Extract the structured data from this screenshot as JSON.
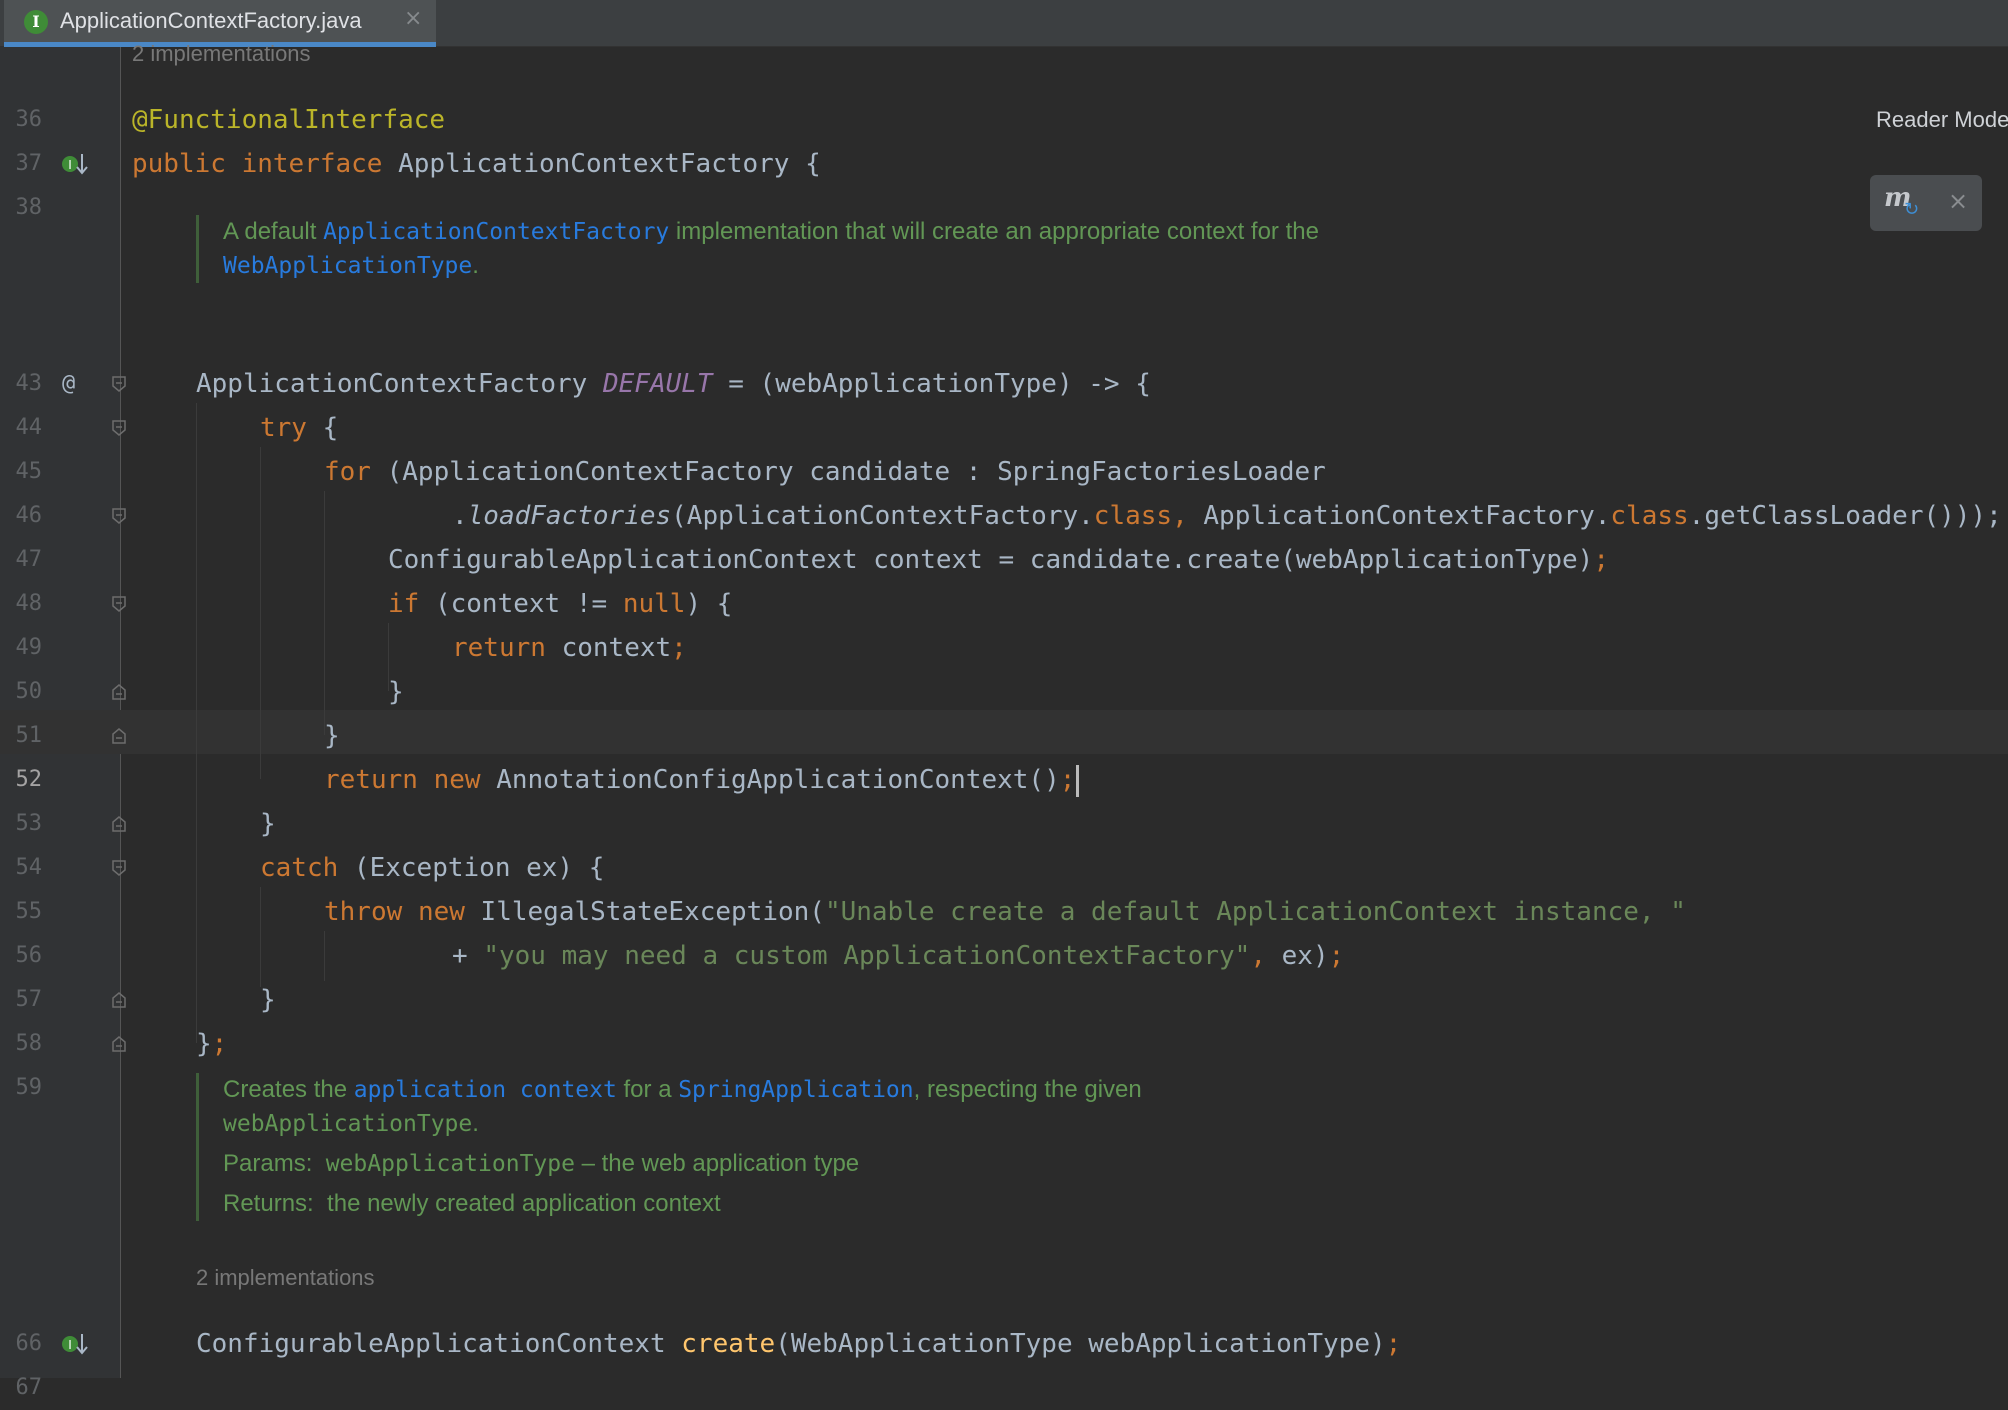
{
  "tab": {
    "file_icon_letter": "I",
    "filename": "ApplicationContextFactory.java",
    "close_glyph": "×"
  },
  "reader_mode": {
    "label": "Reader Mode",
    "maven_glyph": "m",
    "sync_glyph": "↻",
    "close_glyph": "×"
  },
  "hints": {
    "top_implementations": "2 implementations",
    "bottom_implementations": "2 implementations"
  },
  "gutter": {
    "line_numbers": [
      "36",
      "37",
      "38",
      "43",
      "44",
      "45",
      "46",
      "47",
      "48",
      "49",
      "50",
      "51",
      "52",
      "53",
      "54",
      "55",
      "56",
      "57",
      "58",
      "59",
      "66",
      "67"
    ],
    "current_line": "52",
    "at_marker": "@",
    "icons": [
      "implementation-down-arrow-icon",
      "override-at-icon",
      "fold-marker-icon"
    ]
  },
  "code": {
    "l36": "@FunctionalInterface",
    "l37_public": "public",
    "l37_interface": "interface",
    "l37_name": " ApplicationContextFactory {",
    "l43_type": "ApplicationContextFactory ",
    "l43_const": "DEFAULT",
    "l43_rest": " = (webApplicationType) -> {",
    "l44_try": "try",
    "l44_rest": " {",
    "l45_for": "for",
    "l45_rest": " (ApplicationContextFactory candidate : SpringFactoriesLoader",
    "l46_dot": ".",
    "l46_method": "loadFactories",
    "l46_a": "(ApplicationContextFactory.",
    "l46_class1": "class",
    "l46_comma": ", ",
    "l46_b": "ApplicationContextFactory.",
    "l46_class2": "class",
    "l46_c": ".getClassLoader()));",
    "l47": "ConfigurableApplicationContext context = candidate.create(webApplicationType)",
    "l47_semi": ";",
    "l48_if": "if",
    "l48_a": " (context != ",
    "l48_null": "null",
    "l48_b": ") {",
    "l49_return": "return",
    "l49_rest": " context",
    "l49_semi": ";",
    "l50": "}",
    "l51": "}",
    "l52_return": "return",
    "l52_new": "new",
    "l52_rest": " AnnotationConfigApplicationContext()",
    "l52_semi": ";",
    "l53": "}",
    "l54_catch": "catch",
    "l54_rest": " (Exception ex) {",
    "l55_throw": "throw",
    "l55_new": "new",
    "l55_rest": " IllegalStateException(",
    "l55_str": "\"Unable create a default ApplicationContext instance, \"",
    "l56_plus": "+ ",
    "l56_str": "\"you may need a custom ApplicationContextFactory\"",
    "l56_comma": ", ",
    "l56_rest": "ex)",
    "l56_semi": ";",
    "l57": "}",
    "l58_brace": "}",
    "l58_semi": ";",
    "l66_type": "ConfigurableApplicationContext ",
    "l66_method": "create",
    "l66_rest": "(WebApplicationType webApplicationType)",
    "l66_semi": ";"
  },
  "doc1": {
    "t1": "A default ",
    "link1": "ApplicationContextFactory",
    "t2": " implementation that will create an appropriate context for the",
    "link2": "WebApplicationType",
    "t3": "."
  },
  "doc2": {
    "t1": "Creates the ",
    "link1": "application context",
    "t2": " for a ",
    "link2": "SpringApplication",
    "t3": ", respecting the given",
    "mono1": "webApplicationType",
    "t4": ".",
    "params_label": "Params:",
    "params_mono": "webApplicationType",
    "params_text": " – the web application type",
    "returns_label": "Returns:",
    "returns_text": "the newly created application context"
  },
  "colors": {
    "background": "#2b2b2b",
    "keyword": "#cc7832",
    "annotation": "#bbb529",
    "string": "#6a8759",
    "doc": "#629755",
    "link": "#287bde",
    "constant": "#9876aa",
    "method": "#ffc66d",
    "tab_underline": "#4a88c7"
  }
}
